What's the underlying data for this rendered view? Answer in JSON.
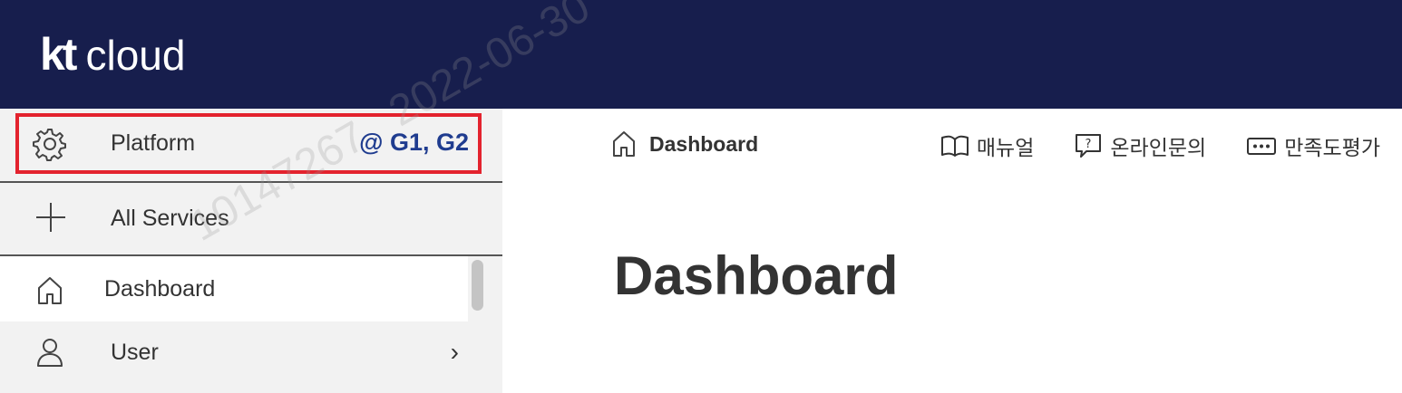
{
  "header": {
    "logo_kt": "kt",
    "logo_cloud": "cloud"
  },
  "sidebar": {
    "platform": {
      "label": "Platform",
      "tag": "@ G1, G2"
    },
    "all_services": {
      "label": "All Services"
    },
    "items": [
      {
        "label": "Dashboard",
        "icon": "home-icon"
      },
      {
        "label": "User",
        "icon": "user-icon",
        "chevron": "›"
      }
    ]
  },
  "main": {
    "breadcrumb": "Dashboard",
    "links": [
      {
        "label": "매뉴얼",
        "icon": "book-icon"
      },
      {
        "label": "온라인문의",
        "icon": "question-chat-icon"
      },
      {
        "label": "만족도평가",
        "icon": "ellipsis-chat-icon"
      }
    ],
    "title": "Dashboard"
  },
  "watermark": {
    "text": "10147267   2022-06-30"
  },
  "colors": {
    "header_bg": "#171e4d",
    "highlight": "#e3232e",
    "tag": "#1f3c8f"
  }
}
